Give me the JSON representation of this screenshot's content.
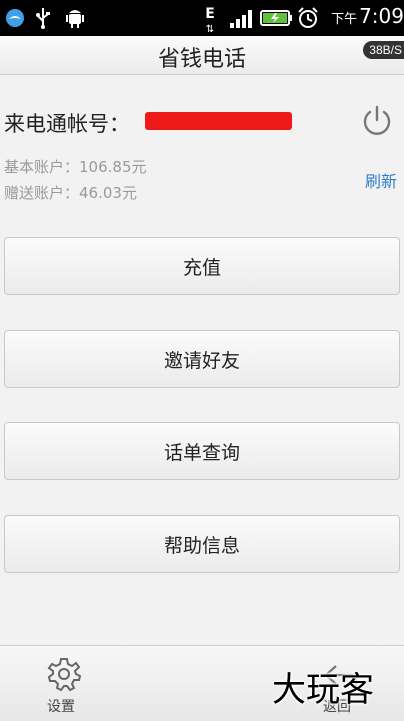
{
  "status_bar": {
    "time": "7:09",
    "ampm": "下午",
    "network": "E"
  },
  "header": {
    "title": "省钱电话",
    "speed_badge": "38B/S"
  },
  "account": {
    "label": "来电通帐号：",
    "basic_balance": "基本账户：106.85元",
    "bonus_balance": "赠送账户：46.03元",
    "refresh_label": "刷新"
  },
  "menu": {
    "items": [
      {
        "label": "充值"
      },
      {
        "label": "邀请好友"
      },
      {
        "label": "话单查询"
      },
      {
        "label": "帮助信息"
      }
    ]
  },
  "bottom_bar": {
    "settings_label": "设置",
    "back_label": "返回"
  },
  "watermark": "大玩客",
  "colors": {
    "redaction": "#ee1a1a",
    "link": "#2f7ec9"
  }
}
